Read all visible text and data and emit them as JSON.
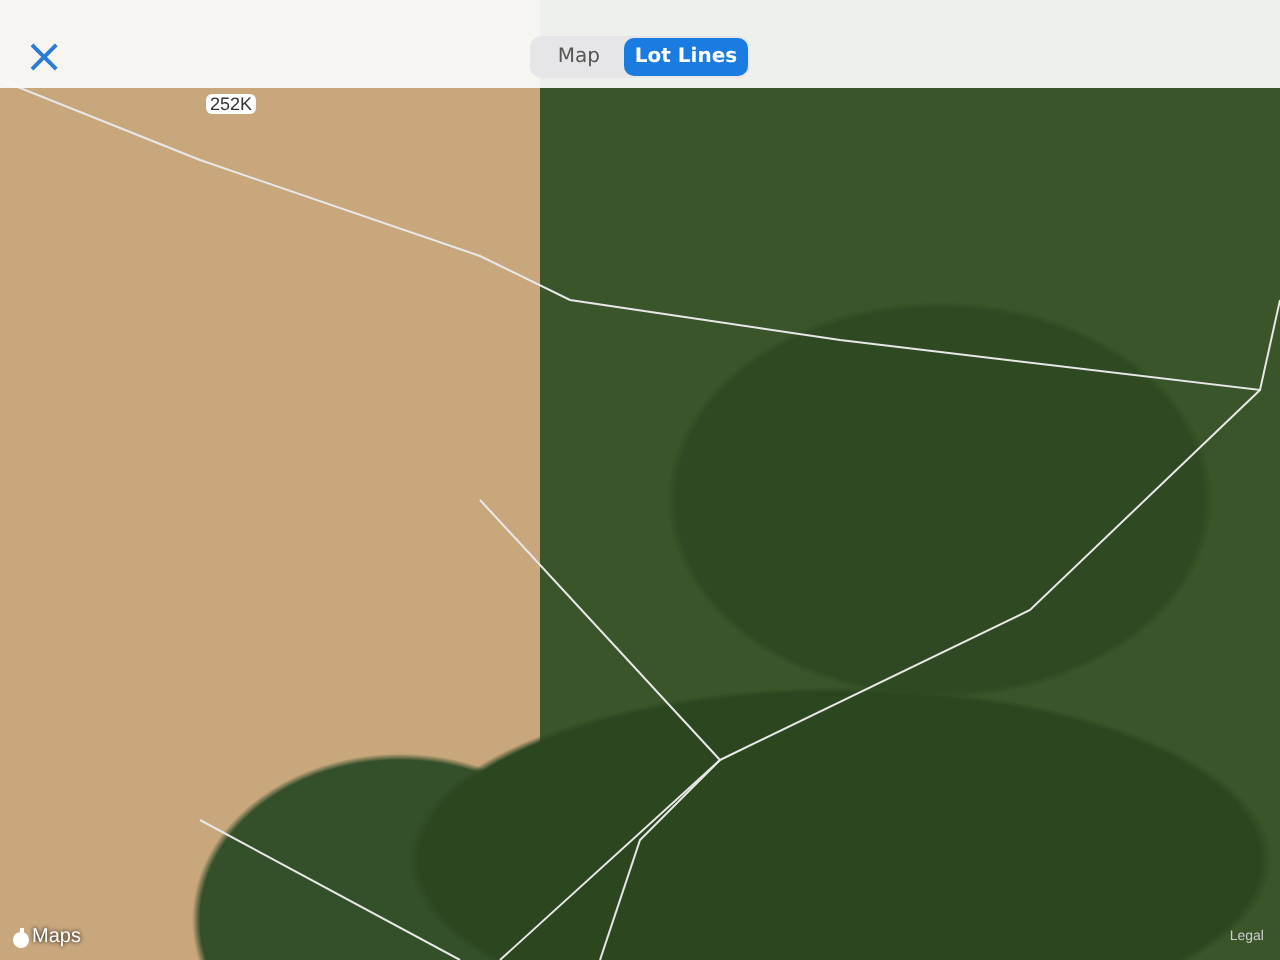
{
  "top_bar": {
    "close": "×"
  },
  "segments": [
    {
      "label": "Map",
      "selected": false
    },
    {
      "label": "Lot Lines",
      "selected": true
    }
  ],
  "map": {
    "road_label": "252K",
    "attribution": "Maps",
    "legal": "Legal"
  }
}
